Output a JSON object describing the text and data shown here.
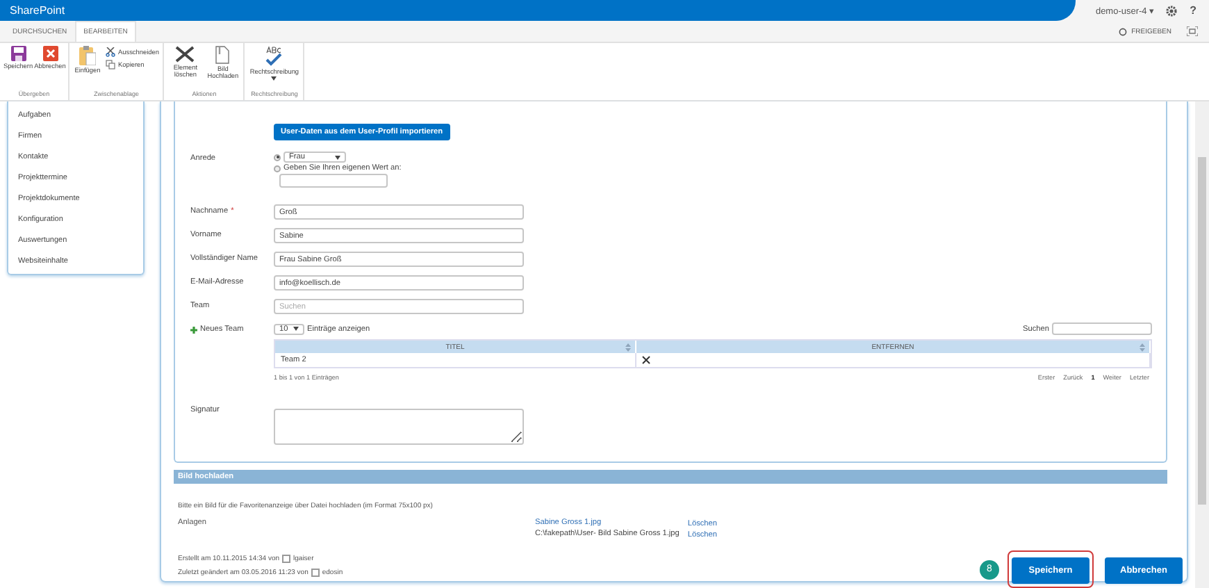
{
  "topbar": {
    "brand": "SharePoint",
    "user": "demo-user-4 ▾",
    "help": "?"
  },
  "tabs": [
    {
      "label": "DURCHSUCHEN",
      "selected": false
    },
    {
      "label": "BEARBEITEN",
      "selected": true
    }
  ],
  "share": "FREIGEBEN",
  "ribbon": [
    {
      "label": "Übergeben",
      "items": [
        {
          "label": "Speichern",
          "kind": "large"
        },
        {
          "label": "Abbrechen",
          "kind": "large"
        }
      ]
    },
    {
      "label": "Zwischenablage",
      "items": [
        {
          "label": "Einfügen",
          "kind": "large"
        },
        {
          "label": "Ausschneiden",
          "kind": "small"
        },
        {
          "label": "Kopieren",
          "kind": "small"
        }
      ]
    },
    {
      "label": "Aktionen",
      "items": [
        {
          "label": "Element löschen",
          "kind": "large"
        },
        {
          "label": "Bild Hochladen",
          "kind": "large"
        }
      ]
    },
    {
      "label": "Rechtschreibung",
      "items": [
        {
          "label": "Rechtschreibung",
          "kind": "dropdown"
        }
      ]
    }
  ],
  "nav": [
    "Aufgaben",
    "Firmen",
    "Kontakte",
    "Projekttermine",
    "Projektdokumente",
    "Konfiguration",
    "Auswertungen",
    "Websiteinhalte"
  ],
  "import_button": "User-Daten aus dem User-Profil importieren",
  "anrede": {
    "label": "Anrede",
    "options": [
      {
        "kind": "select",
        "value": "Frau",
        "selected": true
      },
      {
        "kind": "custom",
        "label": "Geben Sie Ihren eigenen Wert an:",
        "selected": false
      }
    ]
  },
  "fields": [
    {
      "label": "Nachname",
      "marker": "*",
      "value": "Groß"
    },
    {
      "label": "Vorname",
      "value": "Sabine"
    },
    {
      "label": "Vollständiger Name",
      "value": "Frau Sabine Groß"
    },
    {
      "label": "E-Mail-Adresse",
      "value": "info@koellisch.de"
    },
    {
      "label": "Team",
      "placeholder": "Suchen"
    }
  ],
  "team": {
    "label": "Neues Team",
    "page_size": "10",
    "page_size_label": "Einträge anzeigen",
    "search_label": "Suchen",
    "columns": [
      "TITEL",
      "ENTFERNEN"
    ],
    "rows": [
      {
        "title": "Team 2"
      }
    ],
    "info": "1 bis 1 von 1 Einträgen",
    "pager": [
      {
        "label": "Erster",
        "selected": false
      },
      {
        "label": "Zurück",
        "selected": false
      },
      {
        "label": "1",
        "selected": true
      },
      {
        "label": "Weiter",
        "selected": false
      },
      {
        "label": "Letzter",
        "selected": false
      }
    ]
  },
  "signatur": {
    "label": "Signatur"
  },
  "upload": {
    "title": "Bild hochladen",
    "hint": "Bitte ein Bild für die Favoritenanzeige über Datei hochladen (im Format 75x100 px)",
    "attachments_label": "Anlagen",
    "attachments": [
      {
        "kind": "uploaded",
        "name": "Sabine Gross 1.jpg",
        "action": "Löschen"
      },
      {
        "kind": "pending",
        "name": "C:\\fakepath\\User- Bild Sabine Gross 1.jpg",
        "action": "Löschen"
      }
    ]
  },
  "meta": [
    {
      "text": "Erstellt am 10.11.2015 14:34  von",
      "user": "lgaiser"
    },
    {
      "text": "Zuletzt geändert am 03.05.2016 11:23  von",
      "user": "edosin"
    }
  ],
  "buttons": [
    {
      "label": "Speichern",
      "highlighted": true,
      "step": "8"
    },
    {
      "label": "Abbrechen",
      "highlighted": false
    }
  ]
}
